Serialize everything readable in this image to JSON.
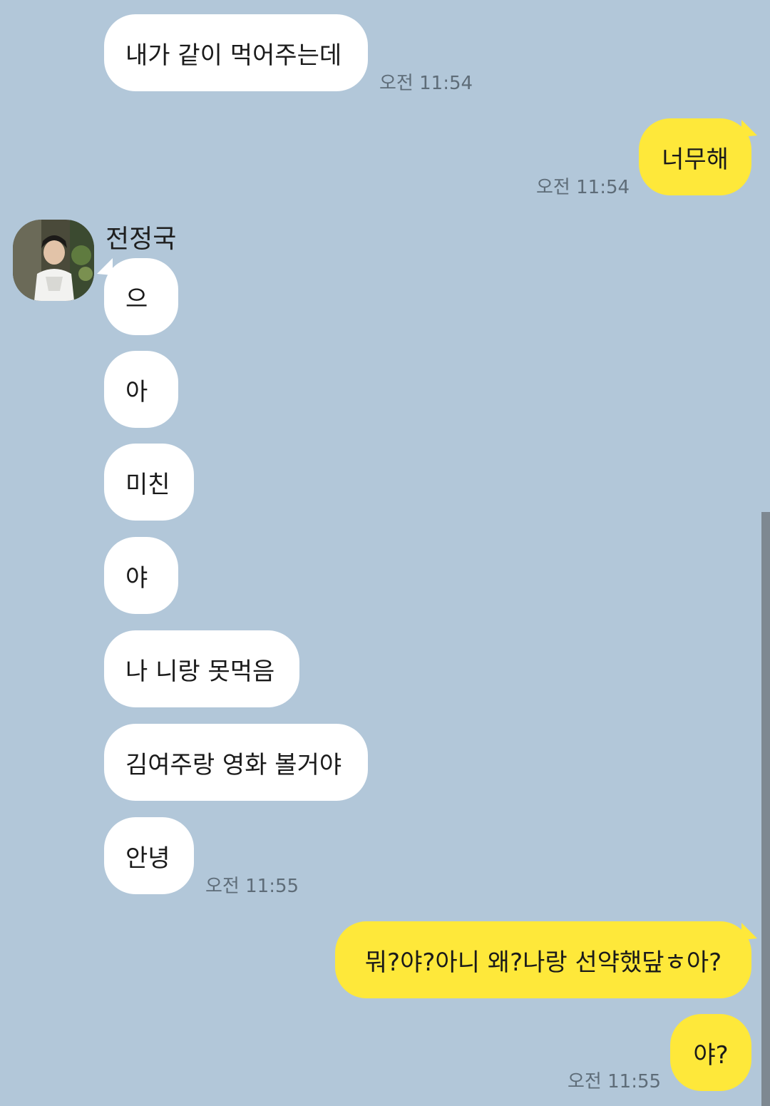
{
  "sender": {
    "name": "전정국",
    "avatar_icon": "profile-photo"
  },
  "messages": [
    {
      "text": "내가 같이 먹어주는데",
      "from": "them",
      "time": "오전 11:54"
    },
    {
      "text": "너무해",
      "from": "me",
      "time": "오전 11:54"
    },
    {
      "text": "으",
      "from": "them"
    },
    {
      "text": "아",
      "from": "them"
    },
    {
      "text": "미친",
      "from": "them"
    },
    {
      "text": "야",
      "from": "them"
    },
    {
      "text": "나 니랑 못먹음",
      "from": "them"
    },
    {
      "text": "김여주랑 영화 볼거야",
      "from": "them"
    },
    {
      "text": "안녕",
      "from": "them",
      "time": "오전 11:55"
    },
    {
      "text": "뭐?야?아니 왜?나랑 선약했닾ㅎ아?",
      "from": "me"
    },
    {
      "text": "야?",
      "from": "me",
      "time": "오전 11:55"
    }
  ],
  "colors": {
    "background": "#b2c7d9",
    "received_bubble": "#ffffff",
    "sent_bubble": "#fee83a",
    "time_text": "#5e6c78"
  }
}
